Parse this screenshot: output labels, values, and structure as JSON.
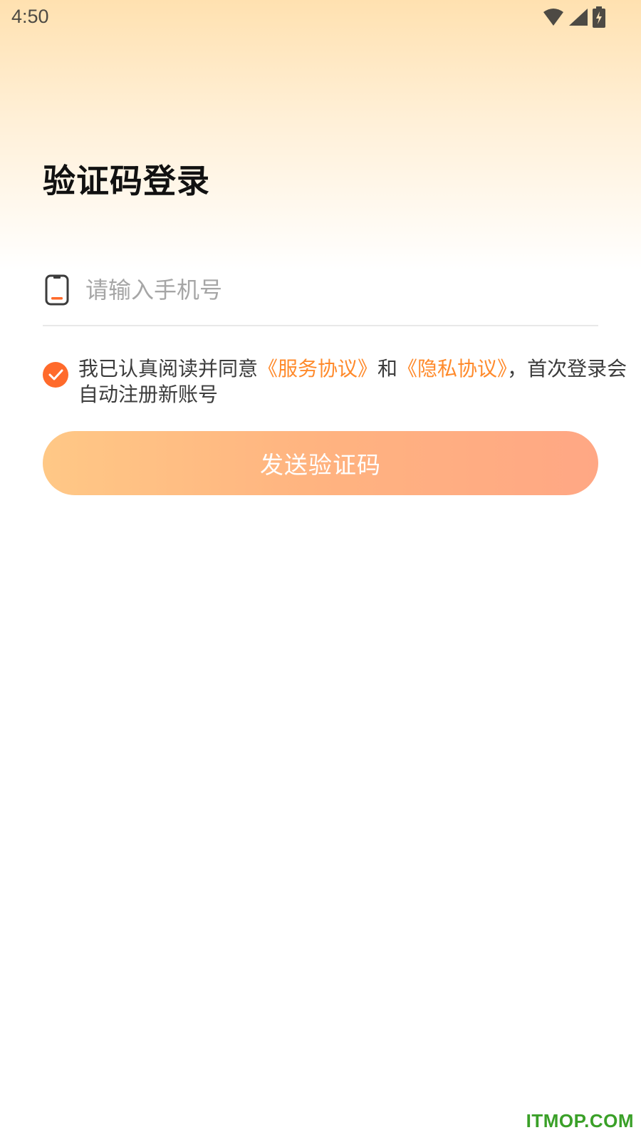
{
  "status_bar": {
    "time": "4:50"
  },
  "page": {
    "title": "验证码登录"
  },
  "phone": {
    "placeholder": "请输入手机号",
    "value": ""
  },
  "agreement": {
    "checked": true,
    "text_before": "我已认真阅读并同意",
    "service_link": "《服务协议》",
    "and_text": "和",
    "privacy_link": "《隐私协议》",
    "text_after": "，首次登录会自动注册新账号"
  },
  "send_button": {
    "label": "发送验证码"
  },
  "watermark": {
    "text": "ITMOP.COM"
  },
  "colors": {
    "accent": "#ff6a2b",
    "link": "#ff8a2b",
    "button_start": "#ffc886",
    "button_end": "#ffa784"
  },
  "icons": {
    "phone": "phone-icon",
    "check": "check-icon",
    "wifi": "wifi-icon",
    "signal": "signal-icon",
    "battery": "battery-charging-icon"
  }
}
